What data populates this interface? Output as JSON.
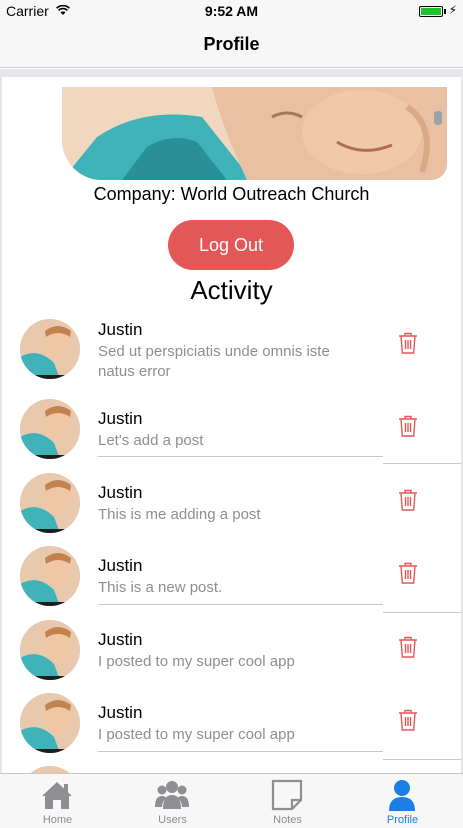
{
  "status_bar": {
    "carrier": "Carrier",
    "time": "9:52 AM"
  },
  "nav": {
    "title": "Profile"
  },
  "profile": {
    "company": "Company: World Outreach Church",
    "logout_label": "Log Out"
  },
  "activity": {
    "title": "Activity",
    "items": [
      {
        "name": "Justin",
        "text": "Sed ut perspiciatis unde omnis iste natus error"
      },
      {
        "name": "Justin",
        "text": "Let's add a post"
      },
      {
        "name": "Justin",
        "text": "This is me adding a post"
      },
      {
        "name": "Justin",
        "text": "This is a new post."
      },
      {
        "name": "Justin",
        "text": "I posted to my super cool app"
      },
      {
        "name": "Justin",
        "text": "I posted to my super cool app"
      }
    ]
  },
  "tabs": [
    {
      "label": "Home",
      "icon": "home-icon",
      "active": false
    },
    {
      "label": "Users",
      "icon": "users-icon",
      "active": false
    },
    {
      "label": "Notes",
      "icon": "notes-icon",
      "active": false
    },
    {
      "label": "Profile",
      "icon": "profile-icon",
      "active": true
    }
  ],
  "colors": {
    "accent": "#1a7ee6",
    "logout": "#e35757",
    "trash": "#e35757",
    "battery": "#22c02a",
    "secondary_text": "#8e8e93"
  }
}
